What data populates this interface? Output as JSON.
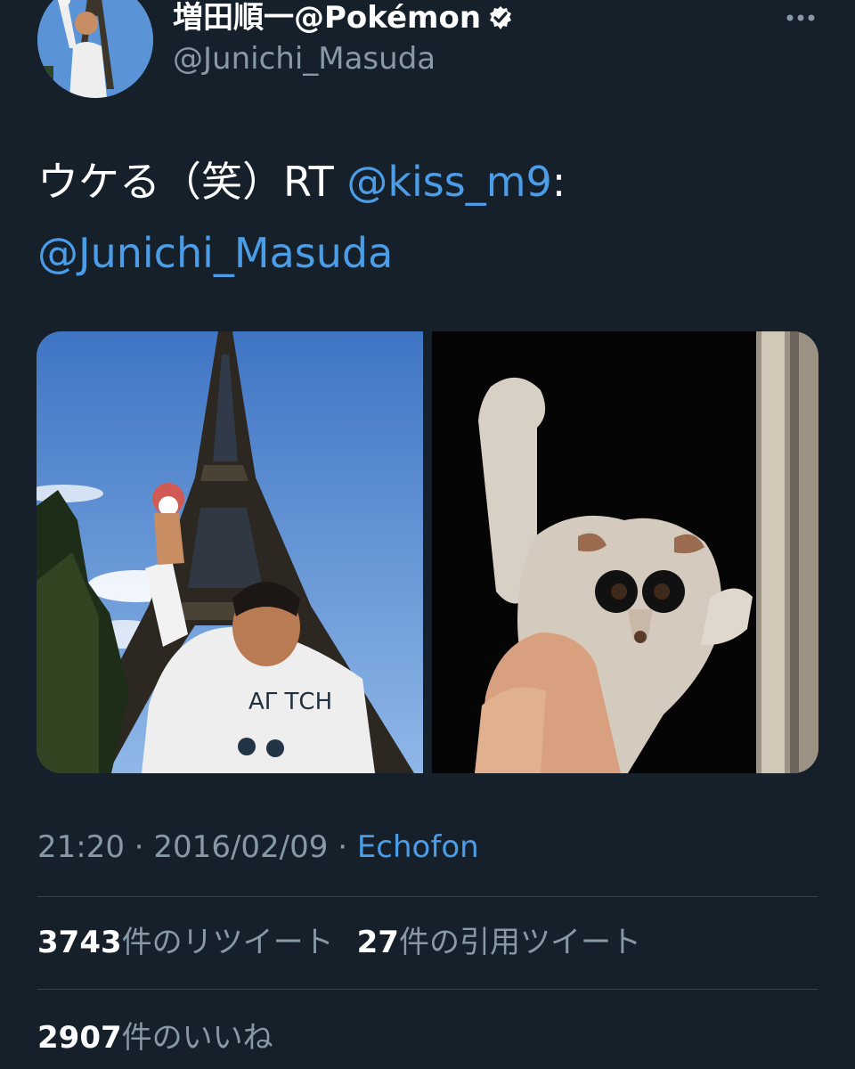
{
  "colors": {
    "background": "#15202b",
    "primary_text": "#ffffff",
    "secondary_text": "#8899a6",
    "link": "#4a9de6",
    "divider": "#38444d"
  },
  "author": {
    "display_name": "増田順一@Pokémon",
    "handle": "@Junichi_Masuda",
    "verified_icon": "verified-badge-icon",
    "avatar_icon": "profile-avatar"
  },
  "actions": {
    "more_icon": "more-horizontal-icon"
  },
  "tweet": {
    "text_before_mention": "ウケる（笑）RT ",
    "mention_1": "@kiss_m9",
    "text_after_mention_1": ":",
    "mention_2": "@Junichi_Masuda",
    "media": [
      {
        "name": "eiffel-tower-photo"
      },
      {
        "name": "slow-loris-photo"
      }
    ]
  },
  "meta": {
    "time": "21:20",
    "sep_1": " · ",
    "date": "2016/02/09",
    "sep_2": " · ",
    "source": "Echofon"
  },
  "stats": {
    "retweets_count": "3743",
    "retweets_label": "件のリツイート",
    "quotes_count": "27",
    "quotes_label": "件の引用ツイート",
    "likes_count": "2907",
    "likes_label": "件のいいね"
  }
}
